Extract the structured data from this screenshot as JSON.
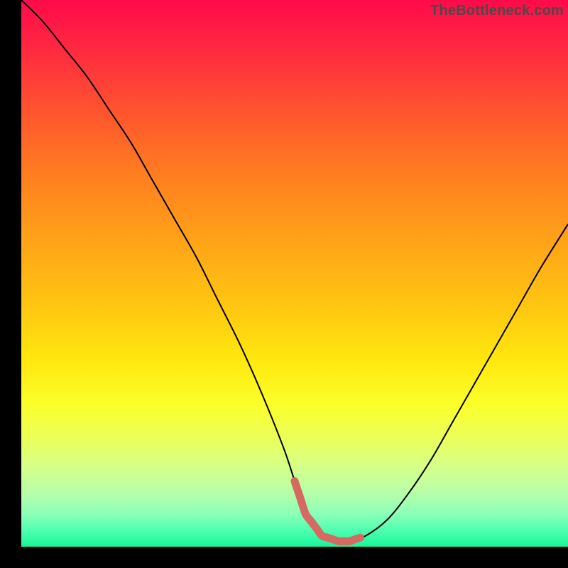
{
  "watermark": {
    "text": "TheBottleneck.com"
  },
  "colors": {
    "frame": "#000000",
    "curve": "#000000",
    "highlight": "#d46a62",
    "watermark": "#4a4a4a"
  },
  "chart_data": {
    "type": "line",
    "title": "",
    "xlabel": "",
    "ylabel": "",
    "xlim": [
      0,
      100
    ],
    "ylim": [
      0,
      100
    ],
    "grid": false,
    "legend": false,
    "series": [
      {
        "name": "bottleneck-curve",
        "x": [
          0,
          4,
          8,
          12,
          16,
          20,
          24,
          28,
          32,
          36,
          40,
          44,
          48,
          50,
          52,
          55,
          58,
          60,
          63,
          67,
          71,
          75,
          79,
          83,
          87,
          91,
          95,
          100
        ],
        "values": [
          100,
          96,
          91,
          86,
          80,
          74,
          67,
          60,
          53,
          45,
          37,
          28,
          18,
          12,
          6,
          2,
          1,
          1,
          2,
          5,
          10,
          16,
          23,
          30,
          37,
          44,
          51,
          59
        ]
      }
    ],
    "highlight_segment": {
      "series": "bottleneck-curve",
      "x_start": 50,
      "x_end": 62
    }
  }
}
